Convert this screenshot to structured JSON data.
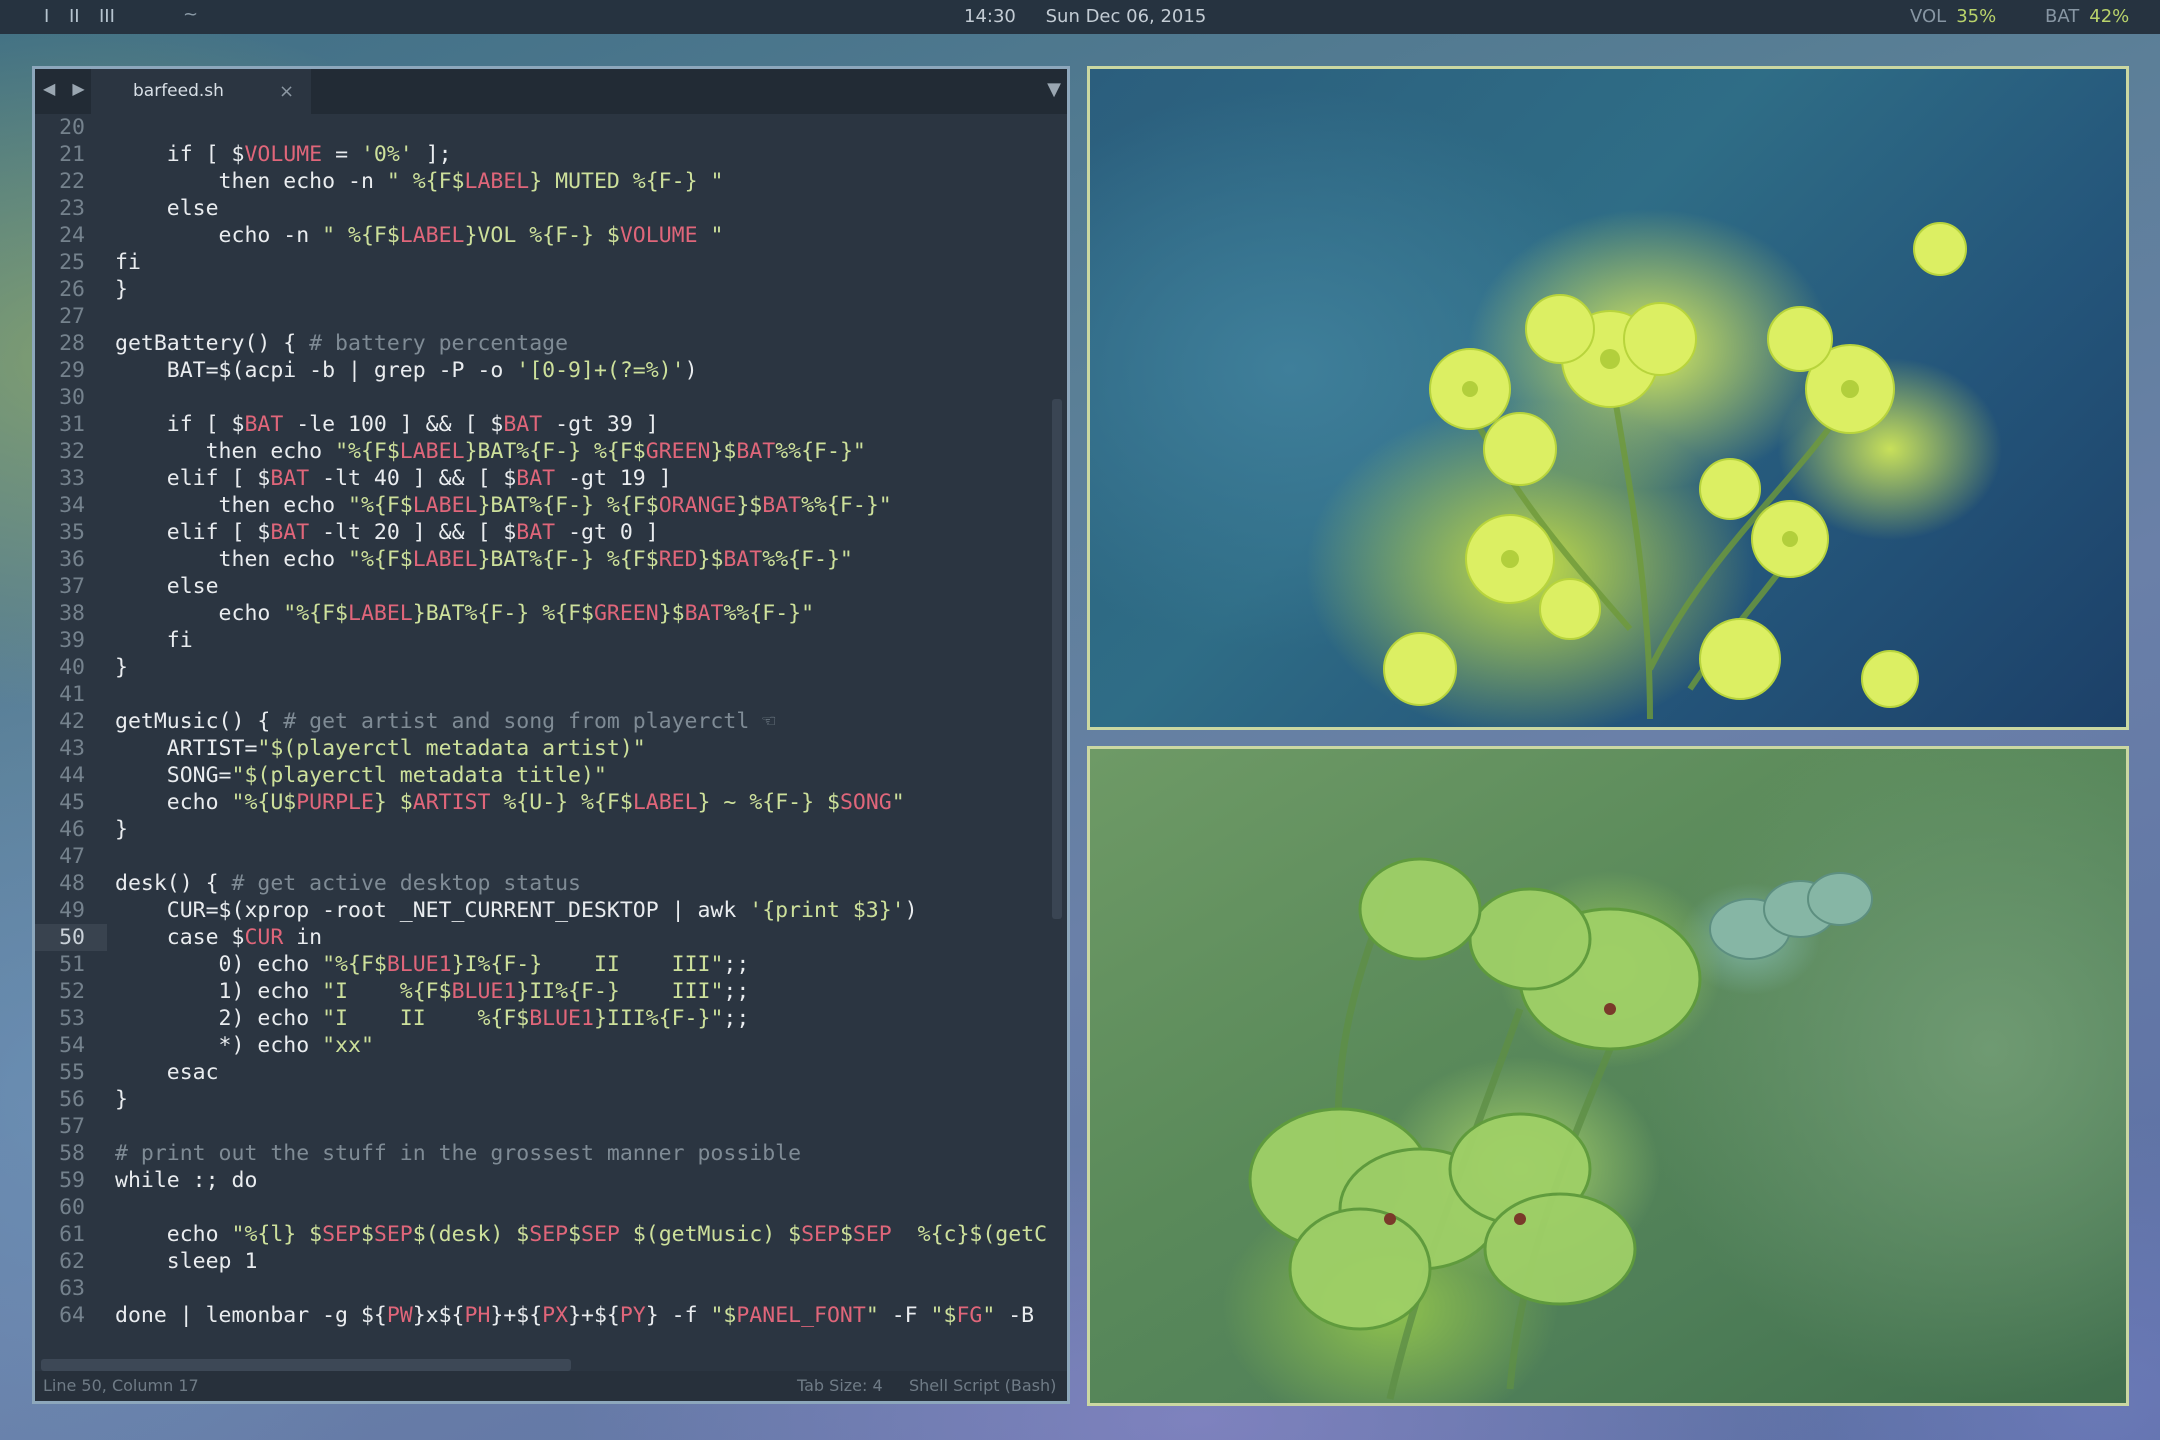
{
  "topbar": {
    "workspaces": [
      "I",
      "II",
      "III"
    ],
    "separator": "~",
    "time": "14:30",
    "date": "Sun Dec 06, 2015",
    "vol_label": "VOL",
    "vol_value": "35%",
    "bat_label": "BAT",
    "bat_value": "42%"
  },
  "editor": {
    "nav_arrows": "◀ ▶",
    "tab_name": "barfeed.sh",
    "tab_close": "×",
    "tab_menu": "▼",
    "current_line": 50,
    "lines": [
      {
        "n": "20",
        "segs": []
      },
      {
        "n": "21",
        "segs": [
          [
            "k",
            "    if [ $"
          ],
          [
            "v",
            "VOLUME"
          ],
          [
            "k",
            " = "
          ],
          [
            "s",
            "'0%'"
          ],
          [
            "k",
            " ];"
          ]
        ]
      },
      {
        "n": "22",
        "segs": [
          [
            "k",
            "        then echo -n "
          ],
          [
            "s",
            "\" %{F$"
          ],
          [
            "v",
            "LABEL"
          ],
          [
            "s",
            "} MUTED %{F-} \""
          ]
        ]
      },
      {
        "n": "23",
        "segs": [
          [
            "k",
            "    else"
          ]
        ]
      },
      {
        "n": "24",
        "segs": [
          [
            "k",
            "        echo -n "
          ],
          [
            "s",
            "\" %{F$"
          ],
          [
            "v",
            "LABEL"
          ],
          [
            "s",
            "}VOL %{F-} $"
          ],
          [
            "v",
            "VOLUME"
          ],
          [
            "s",
            " \""
          ]
        ]
      },
      {
        "n": "25",
        "segs": [
          [
            "k",
            "fi"
          ]
        ]
      },
      {
        "n": "26",
        "segs": [
          [
            "k",
            "}"
          ]
        ]
      },
      {
        "n": "27",
        "segs": []
      },
      {
        "n": "28",
        "segs": [
          [
            "k",
            "getBattery() { "
          ],
          [
            "c",
            "# battery percentage"
          ]
        ]
      },
      {
        "n": "29",
        "segs": [
          [
            "k",
            "    BAT=$(acpi -b | grep -P -o "
          ],
          [
            "s",
            "'[0-9]+(?=%)'"
          ],
          [
            "k",
            ")"
          ]
        ]
      },
      {
        "n": "30",
        "segs": []
      },
      {
        "n": "31",
        "segs": [
          [
            "k",
            "    if [ $"
          ],
          [
            "v",
            "BAT"
          ],
          [
            "k",
            " -le 100 ] && [ $"
          ],
          [
            "v",
            "BAT"
          ],
          [
            "k",
            " -gt 39 ]"
          ]
        ]
      },
      {
        "n": "32",
        "segs": [
          [
            "k",
            "       then echo "
          ],
          [
            "s",
            "\"%{F$"
          ],
          [
            "v",
            "LABEL"
          ],
          [
            "s",
            "}BAT%{F-} %{F$"
          ],
          [
            "v",
            "GREEN"
          ],
          [
            "s",
            "}$"
          ],
          [
            "v",
            "BAT"
          ],
          [
            "s",
            "%%{F-}\""
          ]
        ]
      },
      {
        "n": "33",
        "segs": [
          [
            "k",
            "    elif [ $"
          ],
          [
            "v",
            "BAT"
          ],
          [
            "k",
            " -lt 40 ] && [ $"
          ],
          [
            "v",
            "BAT"
          ],
          [
            "k",
            " -gt 19 ]"
          ]
        ]
      },
      {
        "n": "34",
        "segs": [
          [
            "k",
            "        then echo "
          ],
          [
            "s",
            "\"%{F$"
          ],
          [
            "v",
            "LABEL"
          ],
          [
            "s",
            "}BAT%{F-} %{F$"
          ],
          [
            "v",
            "ORANGE"
          ],
          [
            "s",
            "}$"
          ],
          [
            "v",
            "BAT"
          ],
          [
            "s",
            "%%{F-}\""
          ]
        ]
      },
      {
        "n": "35",
        "segs": [
          [
            "k",
            "    elif [ $"
          ],
          [
            "v",
            "BAT"
          ],
          [
            "k",
            " -lt 20 ] && [ $"
          ],
          [
            "v",
            "BAT"
          ],
          [
            "k",
            " -gt 0 ]"
          ]
        ]
      },
      {
        "n": "36",
        "segs": [
          [
            "k",
            "        then echo "
          ],
          [
            "s",
            "\"%{F$"
          ],
          [
            "v",
            "LABEL"
          ],
          [
            "s",
            "}BAT%{F-} %{F$"
          ],
          [
            "v",
            "RED"
          ],
          [
            "s",
            "}$"
          ],
          [
            "v",
            "BAT"
          ],
          [
            "s",
            "%%{F-}\""
          ]
        ]
      },
      {
        "n": "37",
        "segs": [
          [
            "k",
            "    else"
          ]
        ]
      },
      {
        "n": "38",
        "segs": [
          [
            "k",
            "        echo "
          ],
          [
            "s",
            "\"%{F$"
          ],
          [
            "v",
            "LABEL"
          ],
          [
            "s",
            "}BAT%{F-} %{F$"
          ],
          [
            "v",
            "GREEN"
          ],
          [
            "s",
            "}$"
          ],
          [
            "v",
            "BAT"
          ],
          [
            "s",
            "%%{F-}\""
          ]
        ]
      },
      {
        "n": "39",
        "segs": [
          [
            "k",
            "    fi"
          ]
        ]
      },
      {
        "n": "40",
        "segs": [
          [
            "k",
            "}"
          ]
        ]
      },
      {
        "n": "41",
        "segs": []
      },
      {
        "n": "42",
        "segs": [
          [
            "k",
            "getMusic() { "
          ],
          [
            "c",
            "# get artist and song from playerctl ☜"
          ]
        ]
      },
      {
        "n": "43",
        "segs": [
          [
            "k",
            "    ARTIST="
          ],
          [
            "s",
            "\"$(playerctl metadata artist)\""
          ]
        ]
      },
      {
        "n": "44",
        "segs": [
          [
            "k",
            "    SONG="
          ],
          [
            "s",
            "\"$(playerctl metadata title)\""
          ]
        ]
      },
      {
        "n": "45",
        "segs": [
          [
            "k",
            "    echo "
          ],
          [
            "s",
            "\"%{U$"
          ],
          [
            "v",
            "PURPLE"
          ],
          [
            "s",
            "} $"
          ],
          [
            "v",
            "ARTIST"
          ],
          [
            "s",
            " %{U-} %{F$"
          ],
          [
            "v",
            "LABEL"
          ],
          [
            "s",
            "} ~ %{F-} $"
          ],
          [
            "v",
            "SONG"
          ],
          [
            "s",
            "\""
          ]
        ]
      },
      {
        "n": "46",
        "segs": [
          [
            "k",
            "}"
          ]
        ]
      },
      {
        "n": "47",
        "segs": []
      },
      {
        "n": "48",
        "segs": [
          [
            "k",
            "desk() { "
          ],
          [
            "c",
            "# get active desktop status"
          ]
        ]
      },
      {
        "n": "49",
        "segs": [
          [
            "k",
            "    CUR=$(xprop -root _NET_CURRENT_DESKTOP | awk "
          ],
          [
            "s",
            "'{print $3}'"
          ],
          [
            "k",
            ")"
          ]
        ]
      },
      {
        "n": "50",
        "segs": [
          [
            "k",
            "    case $"
          ],
          [
            "v",
            "CUR"
          ],
          [
            "k",
            " in"
          ]
        ]
      },
      {
        "n": "51",
        "segs": [
          [
            "k",
            "        0) echo "
          ],
          [
            "s",
            "\"%{F$"
          ],
          [
            "v",
            "BLUE1"
          ],
          [
            "s",
            "}I%{F-}    II    III\""
          ],
          [
            "k",
            ";;"
          ]
        ]
      },
      {
        "n": "52",
        "segs": [
          [
            "k",
            "        1) echo "
          ],
          [
            "s",
            "\"I    %{F$"
          ],
          [
            "v",
            "BLUE1"
          ],
          [
            "s",
            "}II%{F-}    III\""
          ],
          [
            "k",
            ";;"
          ]
        ]
      },
      {
        "n": "53",
        "segs": [
          [
            "k",
            "        2) echo "
          ],
          [
            "s",
            "\"I    II    %{F$"
          ],
          [
            "v",
            "BLUE1"
          ],
          [
            "s",
            "}III%{F-}\""
          ],
          [
            "k",
            ";;"
          ]
        ]
      },
      {
        "n": "54",
        "segs": [
          [
            "k",
            "        *) echo "
          ],
          [
            "s",
            "\"xx\""
          ]
        ]
      },
      {
        "n": "55",
        "segs": [
          [
            "k",
            "    esac"
          ]
        ]
      },
      {
        "n": "56",
        "segs": [
          [
            "k",
            "}"
          ]
        ]
      },
      {
        "n": "57",
        "segs": []
      },
      {
        "n": "58",
        "segs": [
          [
            "c",
            "# print out the stuff in the grossest manner possible"
          ]
        ]
      },
      {
        "n": "59",
        "segs": [
          [
            "k",
            "while :; do"
          ]
        ]
      },
      {
        "n": "60",
        "segs": []
      },
      {
        "n": "61",
        "segs": [
          [
            "k",
            "    echo "
          ],
          [
            "s",
            "\"%{l} $"
          ],
          [
            "v",
            "SEP"
          ],
          [
            "s",
            "$"
          ],
          [
            "v",
            "SEP"
          ],
          [
            "s",
            "$(desk) $"
          ],
          [
            "v",
            "SEP"
          ],
          [
            "s",
            "$"
          ],
          [
            "v",
            "SEP"
          ],
          [
            "s",
            " $(getMusic) $"
          ],
          [
            "v",
            "SEP"
          ],
          [
            "s",
            "$"
          ],
          [
            "v",
            "SEP"
          ],
          [
            "s",
            "  %{c}$(getC"
          ]
        ]
      },
      {
        "n": "62",
        "segs": [
          [
            "k",
            "    sleep 1"
          ]
        ]
      },
      {
        "n": "63",
        "segs": []
      },
      {
        "n": "64",
        "segs": [
          [
            "k",
            "done | lemonbar -g ${"
          ],
          [
            "v",
            "PW"
          ],
          [
            "k",
            "}x${"
          ],
          [
            "v",
            "PH"
          ],
          [
            "k",
            "}+${"
          ],
          [
            "v",
            "PX"
          ],
          [
            "k",
            "}+${"
          ],
          [
            "v",
            "PY"
          ],
          [
            "k",
            "} -f "
          ],
          [
            "s",
            "\"$"
          ],
          [
            "v",
            "PANEL_FONT"
          ],
          [
            "s",
            "\""
          ],
          [
            "k",
            " -F "
          ],
          [
            "s",
            "\"$"
          ],
          [
            "v",
            "FG"
          ],
          [
            "s",
            "\""
          ],
          [
            "k",
            " -B"
          ]
        ]
      }
    ],
    "status": {
      "position": "Line 50, Column 17",
      "tab_size": "Tab Size: 4",
      "syntax": "Shell Script (Bash)"
    }
  },
  "colors": {
    "accent_green": "#b9d36b",
    "var_red": "#e0667a",
    "string_green": "#cde09b",
    "comment_gray": "#7f8b95"
  }
}
